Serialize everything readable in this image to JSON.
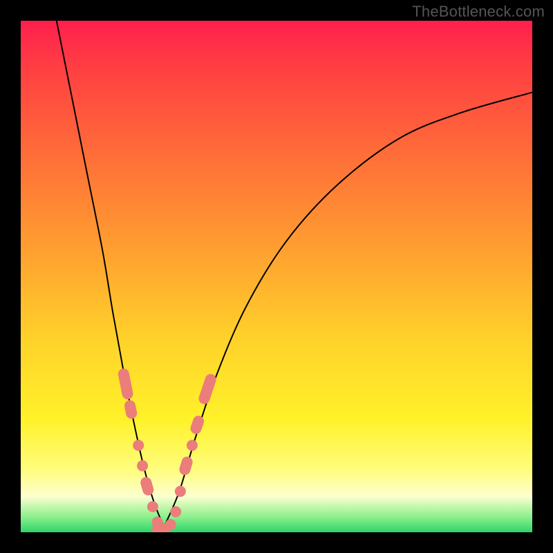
{
  "watermark": "TheBottleneck.com",
  "colors": {
    "bead": "#eb7d7b",
    "curve": "#000000",
    "frame": "#000000",
    "gradient_top": "#ff1f4d",
    "gradient_bottom": "#2fd46a"
  },
  "chart_data": {
    "type": "line",
    "title": "",
    "xlabel": "",
    "ylabel": "",
    "xlim": [
      0,
      100
    ],
    "ylim": [
      0,
      100
    ],
    "grid": false,
    "annotations": [
      {
        "text": "TheBottleneck.com",
        "role": "watermark",
        "position": "top-right"
      }
    ],
    "background_gradient": {
      "orientation": "vertical",
      "meaning": "bottleneck severity (red high, green low)",
      "stops": [
        {
          "pct": 0,
          "color": "#ff1f4d"
        },
        {
          "pct": 25,
          "color": "#ff6a39"
        },
        {
          "pct": 62,
          "color": "#ffd12a"
        },
        {
          "pct": 88,
          "color": "#fffd80"
        },
        {
          "pct": 97,
          "color": "#8cf08c"
        },
        {
          "pct": 100,
          "color": "#2fd46a"
        }
      ]
    },
    "series": [
      {
        "name": "left-curve",
        "role": "bottleneck-profile-left",
        "values": [
          {
            "x": 7,
            "y": 100
          },
          {
            "x": 10,
            "y": 85
          },
          {
            "x": 13,
            "y": 70
          },
          {
            "x": 16,
            "y": 55
          },
          {
            "x": 18,
            "y": 43
          },
          {
            "x": 20,
            "y": 32
          },
          {
            "x": 22,
            "y": 22
          },
          {
            "x": 24,
            "y": 13
          },
          {
            "x": 26,
            "y": 6
          },
          {
            "x": 28,
            "y": 1
          }
        ]
      },
      {
        "name": "right-curve",
        "role": "bottleneck-profile-right",
        "values": [
          {
            "x": 28,
            "y": 1
          },
          {
            "x": 31,
            "y": 8
          },
          {
            "x": 34,
            "y": 18
          },
          {
            "x": 38,
            "y": 30
          },
          {
            "x": 44,
            "y": 44
          },
          {
            "x": 52,
            "y": 57
          },
          {
            "x": 62,
            "y": 68
          },
          {
            "x": 74,
            "y": 77
          },
          {
            "x": 86,
            "y": 82
          },
          {
            "x": 100,
            "y": 86
          }
        ]
      }
    ],
    "markers": [
      {
        "series": "left-curve",
        "x": 20.5,
        "y": 29,
        "kind": "pill",
        "len": 5
      },
      {
        "series": "left-curve",
        "x": 21.5,
        "y": 24,
        "kind": "pill",
        "len": 3
      },
      {
        "series": "left-curve",
        "x": 23.0,
        "y": 17,
        "kind": "dot"
      },
      {
        "series": "left-curve",
        "x": 23.8,
        "y": 13,
        "kind": "dot"
      },
      {
        "series": "left-curve",
        "x": 24.7,
        "y": 9,
        "kind": "pill",
        "len": 3
      },
      {
        "series": "left-curve",
        "x": 25.8,
        "y": 5,
        "kind": "dot"
      },
      {
        "series": "left-curve",
        "x": 26.7,
        "y": 2,
        "kind": "dot"
      },
      {
        "series": "valley",
        "x": 27.5,
        "y": 0.7,
        "kind": "pill",
        "len": 3
      },
      {
        "series": "valley",
        "x": 29.3,
        "y": 1.5,
        "kind": "dot"
      },
      {
        "series": "right-curve",
        "x": 30.3,
        "y": 4,
        "kind": "dot"
      },
      {
        "series": "right-curve",
        "x": 31.2,
        "y": 8,
        "kind": "dot"
      },
      {
        "series": "right-curve",
        "x": 32.3,
        "y": 13,
        "kind": "pill",
        "len": 3
      },
      {
        "series": "right-curve",
        "x": 33.5,
        "y": 17,
        "kind": "dot"
      },
      {
        "series": "right-curve",
        "x": 34.5,
        "y": 21,
        "kind": "pill",
        "len": 3
      },
      {
        "series": "right-curve",
        "x": 36.5,
        "y": 28,
        "kind": "pill",
        "len": 5
      }
    ]
  }
}
